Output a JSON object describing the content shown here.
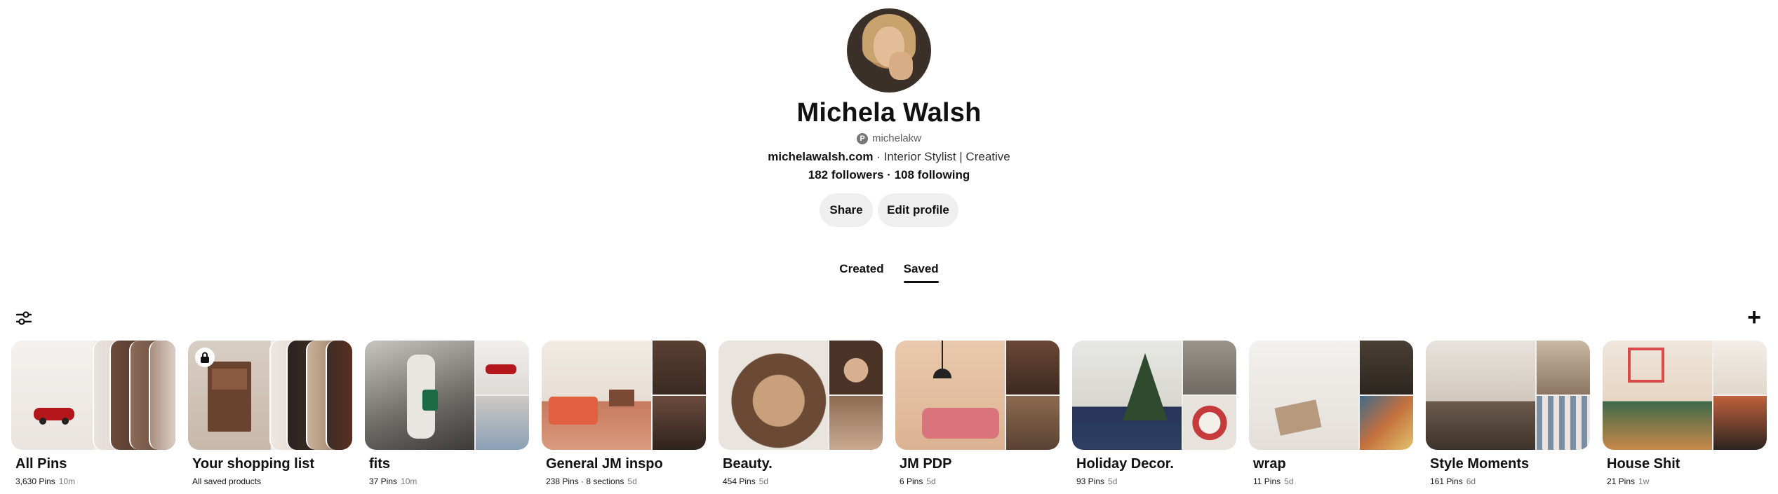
{
  "profile": {
    "name": "Michela Walsh",
    "handle": "michelakw",
    "website": "michelawalsh.com",
    "bio": " · Interior Stylist | Creative",
    "stats": "182 followers · 108 following",
    "share_label": "Share",
    "edit_label": "Edit profile"
  },
  "tabs": [
    "Created",
    "Saved"
  ],
  "active_tab": "Saved",
  "boards": [
    {
      "title": "All Pins",
      "meta": "3,630 Pins",
      "age": "10m"
    },
    {
      "title": "Your shopping list",
      "meta": "All saved products",
      "age": ""
    },
    {
      "title": "fits",
      "meta": "37 Pins",
      "age": "10m"
    },
    {
      "title": "General JM inspo",
      "meta": "238 Pins · 8 sections",
      "age": "5d"
    },
    {
      "title": "Beauty.",
      "meta": "454 Pins",
      "age": "5d"
    },
    {
      "title": "JM PDP",
      "meta": "6 Pins",
      "age": "5d"
    },
    {
      "title": "Holiday Decor.",
      "meta": "93 Pins",
      "age": "5d"
    },
    {
      "title": "wrap",
      "meta": "11 Pins",
      "age": "5d"
    },
    {
      "title": "Style Moments",
      "meta": "161 Pins",
      "age": "6d"
    },
    {
      "title": "House Shit",
      "meta": "21 Pins",
      "age": "1w"
    }
  ],
  "colors": {
    "text": "#111111",
    "button_bg": "#efefef",
    "muted": "#767676"
  }
}
